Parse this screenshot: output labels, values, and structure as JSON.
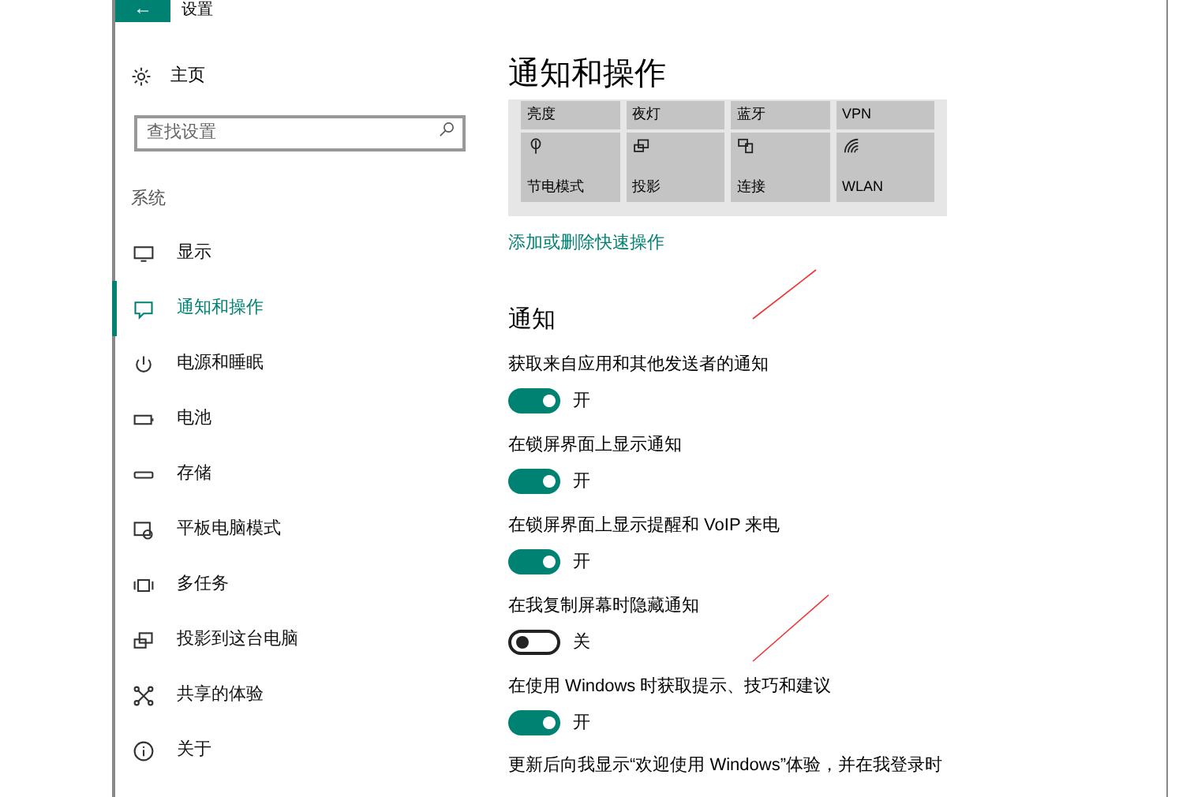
{
  "window": {
    "back": "←",
    "title": "设置"
  },
  "sidebar": {
    "home": "主页",
    "search": {
      "placeholder": "查找设置"
    },
    "section": "系统",
    "items": [
      {
        "label": "显示",
        "selected": false
      },
      {
        "label": "通知和操作",
        "selected": true
      },
      {
        "label": "电源和睡眠",
        "selected": false
      },
      {
        "label": "电池",
        "selected": false
      },
      {
        "label": "存储",
        "selected": false
      },
      {
        "label": "平板电脑模式",
        "selected": false
      },
      {
        "label": "多任务",
        "selected": false
      },
      {
        "label": "投影到这台电脑",
        "selected": false
      },
      {
        "label": "共享的体验",
        "selected": false
      },
      {
        "label": "关于",
        "selected": false
      }
    ]
  },
  "page": {
    "title": "通知和操作",
    "quick_actions": [
      {
        "label": "亮度"
      },
      {
        "label": "夜灯"
      },
      {
        "label": "蓝牙"
      },
      {
        "label": "VPN"
      },
      {
        "label": "节电模式"
      },
      {
        "label": "投影"
      },
      {
        "label": "连接"
      },
      {
        "label": "WLAN"
      }
    ],
    "quick_link": "添加或删除快速操作",
    "section": "通知",
    "settings": [
      {
        "label": "获取来自应用和其他发送者的通知",
        "on": true,
        "state": "开"
      },
      {
        "label": "在锁屏界面上显示通知",
        "on": true,
        "state": "开"
      },
      {
        "label": "在锁屏界面上显示提醒和 VoIP 来电",
        "on": true,
        "state": "开"
      },
      {
        "label": "在我复制屏幕时隐藏通知",
        "on": false,
        "state": "关"
      },
      {
        "label": "在使用 Windows 时获取提示、技巧和建议",
        "on": true,
        "state": "开"
      }
    ],
    "footer_text": "更新后向我显示“欢迎使用 Windows”体验，并在我登录时"
  }
}
